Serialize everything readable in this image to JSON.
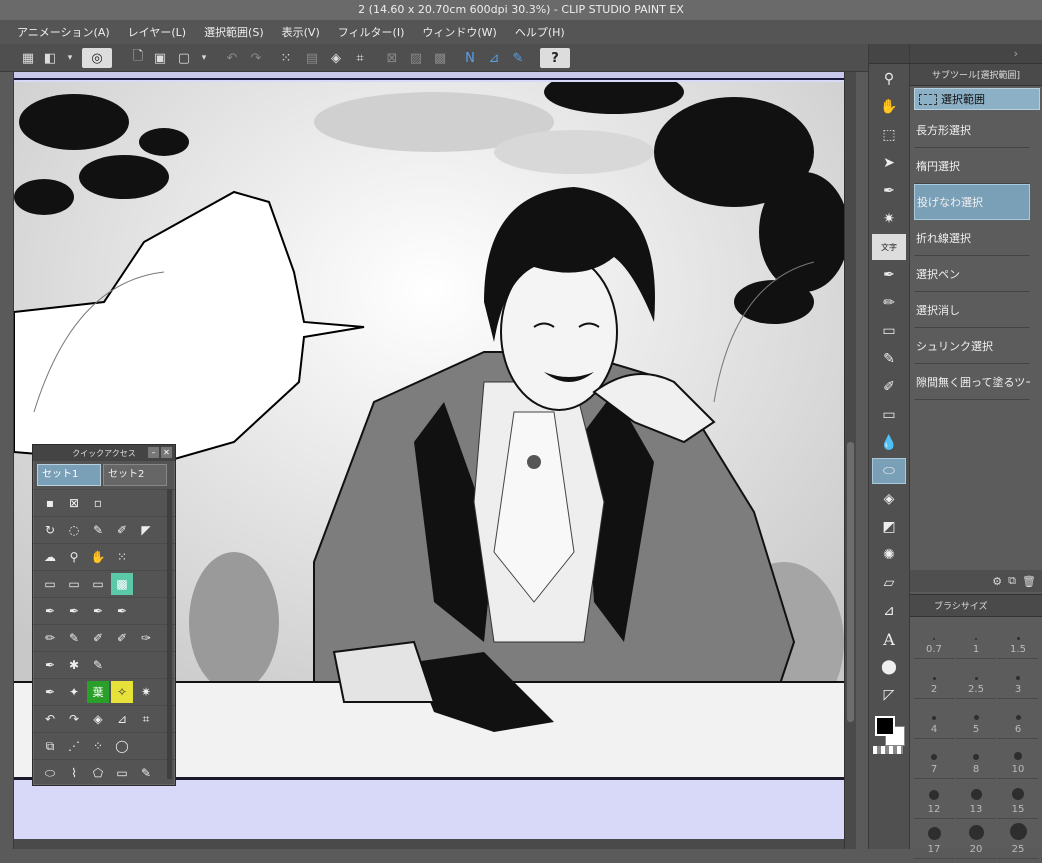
{
  "window": {
    "title": "2 (14.60 x 20.70cm 600dpi 30.3%)  - CLIP STUDIO PAINT EX"
  },
  "menu": [
    "アニメーション(A)",
    "レイヤー(L)",
    "選択範囲(S)",
    "表示(V)",
    "フィルター(I)",
    "ウィンドウ(W)",
    "ヘルプ(H)"
  ],
  "toolbar": {
    "icons": [
      "grid-icon",
      "menu-icon",
      "spiral-icon",
      "new-file-icon",
      "open-folder-icon",
      "save-icon",
      "undo-icon",
      "redo-icon",
      "selection-dots-icon",
      "transform-icon",
      "fill-icon",
      "crop-icon",
      "clear-icon",
      "hatch-icon",
      "fit-icon",
      "ruler-n-icon",
      "ruler-bend-icon",
      "ruler-pen-icon",
      "help-icon"
    ],
    "help_label": "?"
  },
  "sub_tool": {
    "tab_label": "サブツール[選択範囲]",
    "group_label": "選択範囲",
    "items": [
      "長方形選択",
      "楕円選択",
      "投げなわ選択",
      "折れ線選択",
      "選択ペン",
      "選択消し",
      "シュリンク選択",
      "隙間無く囲って塗るツー"
    ],
    "active_index": 2
  },
  "brush_size": {
    "tab_label": "ブラシサイズ",
    "sizes": [
      "0.7",
      "1",
      "1.5",
      "2",
      "2.5",
      "3",
      "4",
      "5",
      "6",
      "7",
      "8",
      "10",
      "12",
      "13",
      "15",
      "17",
      "20",
      "25"
    ]
  },
  "quick_access": {
    "title": "クイックアクセス",
    "sets": [
      "セット1",
      "セット2"
    ],
    "active_set": 0,
    "leaf_glyph": "葉"
  },
  "tools": {
    "letter_tool": "A",
    "text_icon_glyph": "文字"
  },
  "colors": {
    "accent": "#7aa0b8",
    "panel": "#5c5c5c",
    "canvas_bg": "#d8d8f8"
  }
}
